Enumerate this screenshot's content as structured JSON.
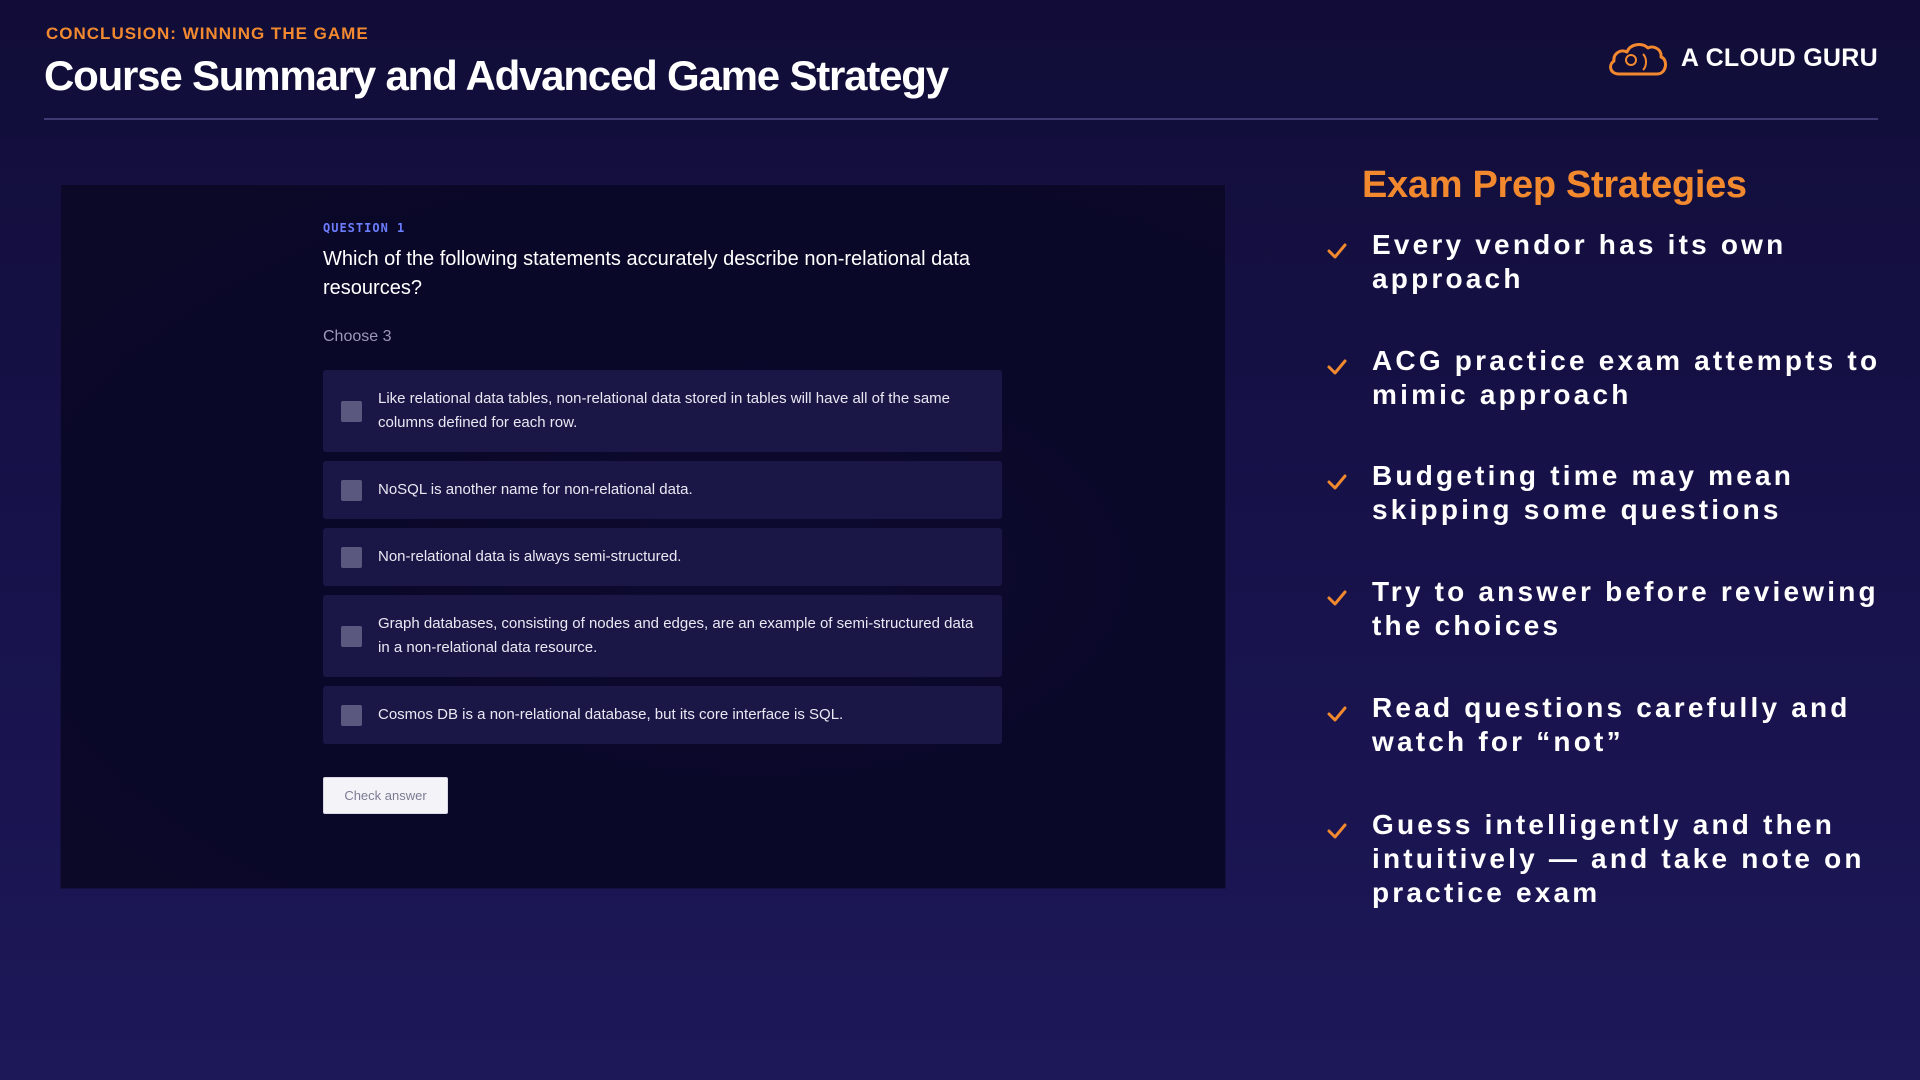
{
  "header": {
    "eyebrow": "CONCLUSION: WINNING THE GAME",
    "title": "Course Summary and Advanced Game Strategy",
    "brand": "A CLOUD GURU",
    "brand_icon": "cloud-logo-icon"
  },
  "quiz": {
    "question_label": "QUESTION 1",
    "question_text": "Which of the following statements accurately describe non-relational data resources?",
    "hint": "Choose 3",
    "options": [
      "Like relational data tables, non-relational data stored in tables will have all of the same columns defined for each row.",
      "NoSQL is another name for non-relational data.",
      "Non-relational data is always semi-structured.",
      "Graph databases, consisting of nodes and edges, are an example of semi-structured data in a non-relational data resource.",
      "Cosmos DB is a non-relational database, but its core interface is SQL."
    ],
    "check_button": "Check answer"
  },
  "strategies": {
    "title": "Exam Prep Strategies",
    "items": [
      "Every vendor has its own approach",
      "ACG practice exam attempts to mimic approach",
      "Budgeting time may mean skipping some questions",
      "Try to answer before reviewing the choices",
      "Read questions carefully and watch for “not”",
      "Guess intelligently and then intuitively — and take note on practice exam"
    ]
  },
  "colors": {
    "accent": "#f2892f",
    "question_label": "#6c7dff",
    "background": "#17124a"
  }
}
